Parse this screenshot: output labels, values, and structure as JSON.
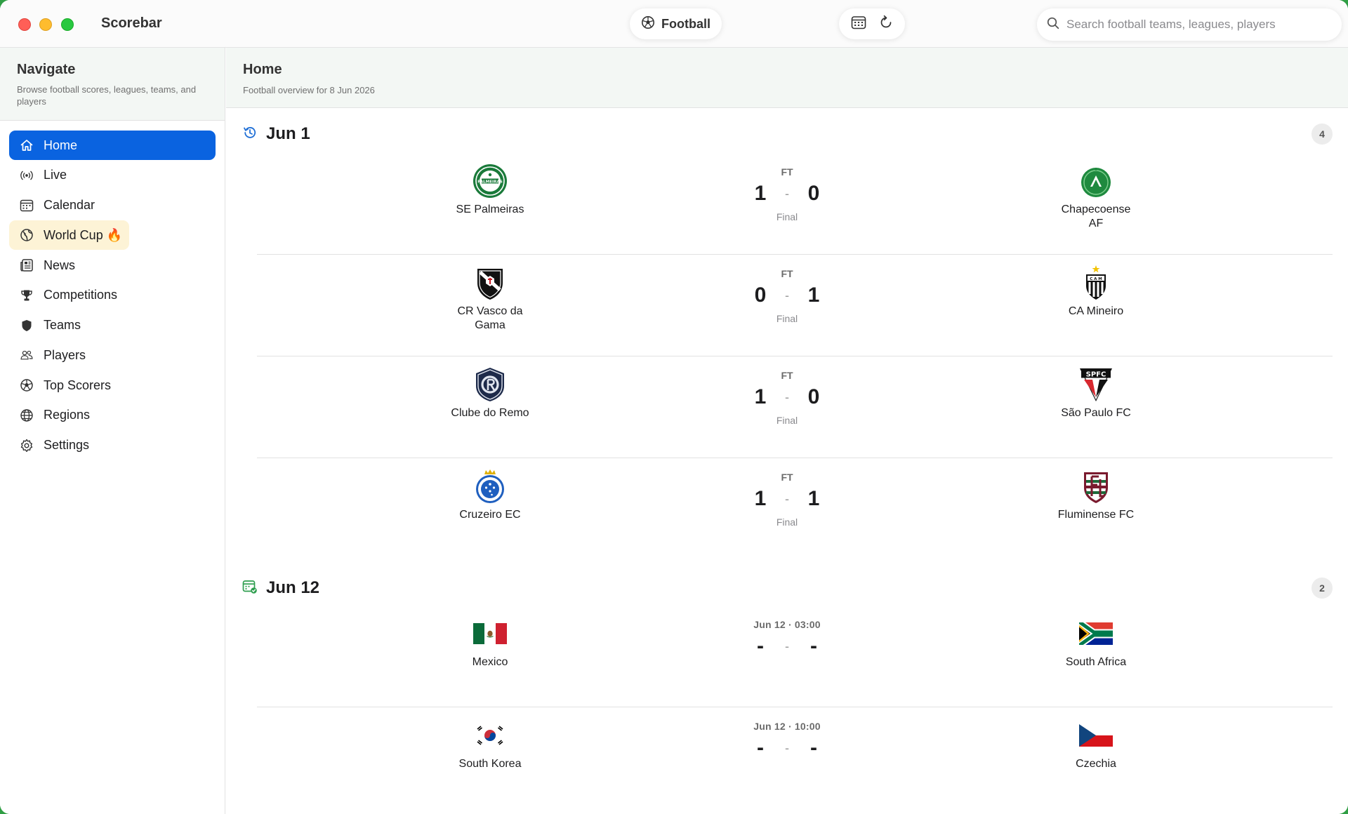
{
  "app": {
    "title": "Scorebar",
    "sport_label": "Football",
    "search_placeholder": "Search football teams, leagues, players"
  },
  "sidebar": {
    "title": "Navigate",
    "subtitle": "Browse football scores, leagues, teams, and players",
    "items": [
      {
        "label": "Home",
        "icon": "house-icon",
        "active": true
      },
      {
        "label": "Live",
        "icon": "broadcast-icon"
      },
      {
        "label": "Calendar",
        "icon": "calendar-icon"
      },
      {
        "label": "World Cup 🔥",
        "icon": "globe-icon",
        "highlight": true
      },
      {
        "label": "News",
        "icon": "newspaper-icon"
      },
      {
        "label": "Competitions",
        "icon": "trophy-icon"
      },
      {
        "label": "Teams",
        "icon": "shield-icon"
      },
      {
        "label": "Players",
        "icon": "people-icon"
      },
      {
        "label": "Top Scorers",
        "icon": "soccer-ball-icon"
      },
      {
        "label": "Regions",
        "icon": "globe-grid-icon"
      },
      {
        "label": "Settings",
        "icon": "gear-icon"
      }
    ]
  },
  "main": {
    "title": "Home",
    "subtitle": "Football overview for 8 Jun 2026",
    "sections": [
      {
        "date": "Jun 1",
        "icon": "history-clock-icon",
        "count": "4",
        "matches": [
          {
            "home": "SE Palmeiras",
            "away": "Chapecoense AF",
            "status_top": "FT",
            "home_score": "1",
            "away_score": "0",
            "separator": "-",
            "status_bottom": "Final"
          },
          {
            "home": "CR Vasco da Gama",
            "away": "CA Mineiro",
            "status_top": "FT",
            "home_score": "0",
            "away_score": "1",
            "separator": "-",
            "status_bottom": "Final"
          },
          {
            "home": "Clube do Remo",
            "away": "São Paulo FC",
            "status_top": "FT",
            "home_score": "1",
            "away_score": "0",
            "separator": "-",
            "status_bottom": "Final"
          },
          {
            "home": "Cruzeiro EC",
            "away": "Fluminense FC",
            "status_top": "FT",
            "home_score": "1",
            "away_score": "1",
            "separator": "-",
            "status_bottom": "Final"
          }
        ]
      },
      {
        "date": "Jun 12",
        "icon": "calendar-badge-icon",
        "count": "2",
        "matches": [
          {
            "home": "Mexico",
            "away": "South Africa",
            "status_top": "Jun 12 · 03:00",
            "home_score": "-",
            "away_score": "-",
            "separator": "-",
            "status_bottom": ""
          },
          {
            "home": "South Korea",
            "away": "Czechia",
            "status_top": "Jun 12 · 10:00",
            "home_score": "-",
            "away_score": "-",
            "separator": "-",
            "status_bottom": ""
          }
        ]
      }
    ]
  },
  "colors": {
    "accent": "#0a63e0",
    "header_bg": "#f3f7f4",
    "highlight_bg": "#fdf3d6",
    "desktop_green": "#2f9e44"
  }
}
